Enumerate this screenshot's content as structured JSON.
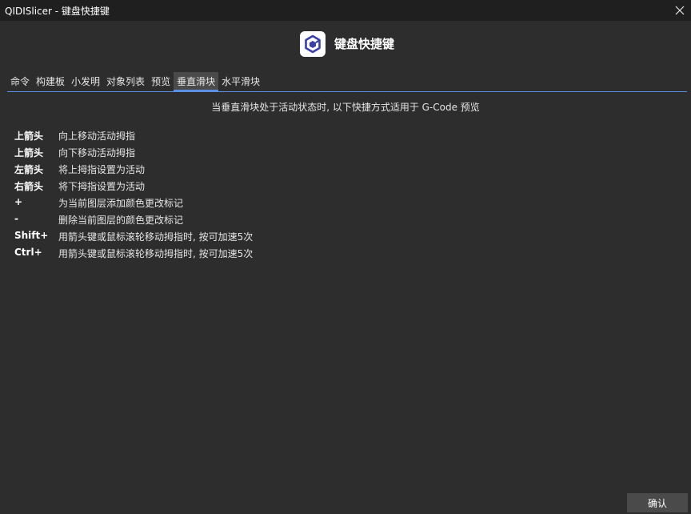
{
  "window": {
    "title": "QIDISlicer - 键盘快捷键"
  },
  "header": {
    "title": "键盘快捷键",
    "logo_icon": "qidi-cube-logo-icon"
  },
  "tabs": [
    {
      "label": "命令",
      "active": false
    },
    {
      "label": "构建板",
      "active": false
    },
    {
      "label": "小发明",
      "active": false
    },
    {
      "label": "对象列表",
      "active": false
    },
    {
      "label": "预览",
      "active": false
    },
    {
      "label": "垂直滑块",
      "active": true
    },
    {
      "label": "水平滑块",
      "active": false
    }
  ],
  "description": "当垂直滑块处于活动状态时, 以下快捷方式适用于 G-Code 预览",
  "shortcuts": [
    {
      "key": "上箭头",
      "desc": "向上移动活动拇指"
    },
    {
      "key": "上箭头",
      "desc": "向下移动活动拇指"
    },
    {
      "key": "左箭头",
      "desc": "将上拇指设置为活动"
    },
    {
      "key": "右箭头",
      "desc": "将下拇指设置为活动"
    },
    {
      "key": "+",
      "desc": "为当前图层添加颜色更改标记"
    },
    {
      "key": "-",
      "desc": "删除当前图层的颜色更改标记"
    },
    {
      "key": "Shift+",
      "desc": "用箭头键或鼠标滚轮移动拇指时, 按可加速5次"
    },
    {
      "key": "Ctrl+",
      "desc": "用箭头键或鼠标滚轮移动拇指时, 按可加速5次"
    }
  ],
  "footer": {
    "ok_label": "确认"
  },
  "colors": {
    "background": "#2d2d2d",
    "titlebar": "#1f1f1f",
    "accent": "#5b8fe6",
    "logo_blue": "#3a3fa8"
  }
}
